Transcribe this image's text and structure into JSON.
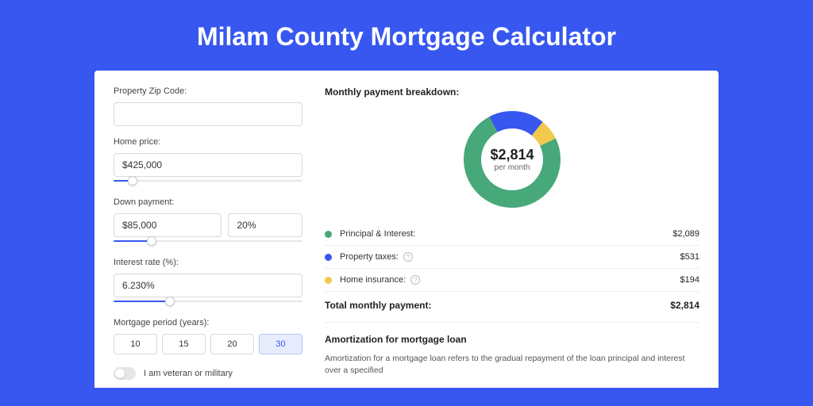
{
  "title": "Milam County Mortgage Calculator",
  "form": {
    "zip_label": "Property Zip Code:",
    "zip_value": "",
    "home_price_label": "Home price:",
    "home_price_value": "$425,000",
    "home_price_slider_pct": 10,
    "down_label": "Down payment:",
    "down_amount": "$85,000",
    "down_pct": "20%",
    "down_slider_pct": 20,
    "rate_label": "Interest rate (%):",
    "rate_value": "6.230%",
    "rate_slider_pct": 30,
    "period_label": "Mortgage period (years):",
    "periods": [
      "10",
      "15",
      "20",
      "30"
    ],
    "period_active": "30",
    "veteran_label": "I am veteran or military",
    "veteran_on": false
  },
  "breakdown": {
    "title": "Monthly payment breakdown:",
    "center_value": "$2,814",
    "center_sub": "per month",
    "items": [
      {
        "label": "Principal & Interest:",
        "value": "$2,089",
        "color": "#47a879",
        "info": false,
        "pct": 74.2
      },
      {
        "label": "Property taxes:",
        "value": "$531",
        "color": "#3757f0",
        "info": true,
        "pct": 18.9
      },
      {
        "label": "Home insurance:",
        "value": "$194",
        "color": "#f0c94e",
        "info": true,
        "pct": 6.9
      }
    ],
    "total_label": "Total monthly payment:",
    "total_value": "$2,814"
  },
  "amortization": {
    "title": "Amortization for mortgage loan",
    "text": "Amortization for a mortgage loan refers to the gradual repayment of the loan principal and interest over a specified"
  }
}
